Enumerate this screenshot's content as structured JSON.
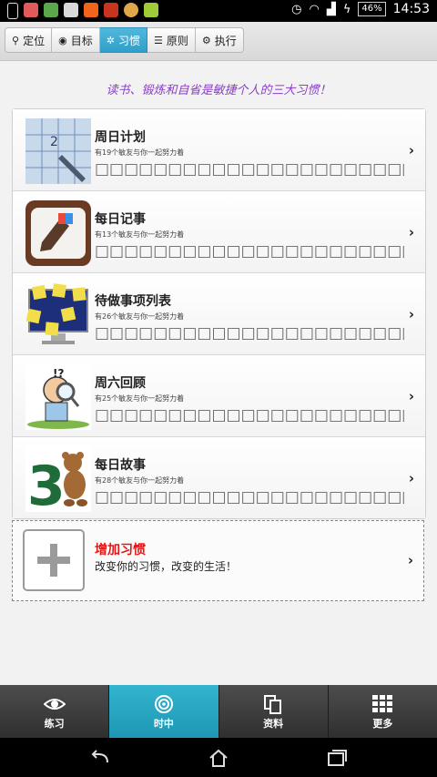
{
  "status_bar": {
    "battery": "46%",
    "time": "14:53"
  },
  "tabs": [
    {
      "label": "定位",
      "icon": "map-pin-icon"
    },
    {
      "label": "目标",
      "icon": "target-icon"
    },
    {
      "label": "习惯",
      "icon": "gear-icon",
      "active": true
    },
    {
      "label": "原则",
      "icon": "list-icon"
    },
    {
      "label": "执行",
      "icon": "gears-icon"
    }
  ],
  "motto": "读书、锻炼和自省是敏捷个人的三大习惯！",
  "habits": [
    {
      "title": "周日计划",
      "subtitle": "有19个敏友与你一起努力着",
      "desc": "□□□□□□□□□□□□□□□□□□□□□□□□□□",
      "thumb": "calendar-icon"
    },
    {
      "title": "每日记事",
      "subtitle": "有13个敏友与你一起努力着",
      "desc": "□□□□□□□□□□□□□□□□□□□□□□□□□□",
      "thumb": "notebook-icon"
    },
    {
      "title": "待做事项列表",
      "subtitle": "有26个敏友与你一起努力着",
      "desc": "□□□□□□□□□□□□□□□□□□□□□□□□□□",
      "thumb": "sticky-notes-icon"
    },
    {
      "title": "周六回顾",
      "subtitle": "有25个敏友与你一起努力着",
      "desc": "□□□□□□□□□□□□□□□□□□□□□□□□□□",
      "thumb": "magnifier-person-icon"
    },
    {
      "title": "每日故事",
      "subtitle": "有28个敏友与你一起努力着",
      "desc": "□□□□□□□□□□□□□□□□□□□□□□□□□□",
      "thumb": "bear-number-three-icon"
    }
  ],
  "add_habit": {
    "title": "增加习惯",
    "subtitle": "改变你的习惯，改变的生活！"
  },
  "bottom_nav": [
    {
      "label": "练习",
      "icon": "eye-icon"
    },
    {
      "label": "时中",
      "icon": "radar-icon",
      "active": true
    },
    {
      "label": "资料",
      "icon": "documents-icon"
    },
    {
      "label": "更多",
      "icon": "grid-icon"
    }
  ],
  "colors": {
    "accent": "#2f9fc9",
    "motto": "#8a3fc7",
    "add_title": "#e21818"
  }
}
